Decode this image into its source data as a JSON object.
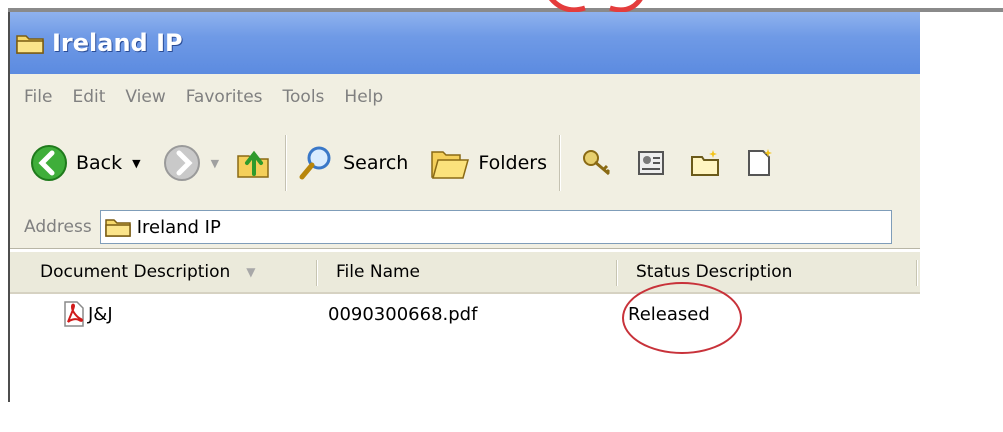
{
  "window": {
    "title": "Ireland IP"
  },
  "menu": [
    "File",
    "Edit",
    "View",
    "Favorites",
    "Tools",
    "Help"
  ],
  "toolbar": {
    "back_label": "Back",
    "search_label": "Search",
    "folders_label": "Folders"
  },
  "address": {
    "label": "Address",
    "value": "Ireland IP"
  },
  "columns": [
    "Document Description",
    "File Name",
    "Status Description"
  ],
  "rows": [
    {
      "description": "J&J",
      "file_name": "0090300668.pdf",
      "status": "Released"
    }
  ],
  "colors": {
    "titlebar": "#6f9ae6",
    "chrome": "#f1efe2",
    "annotation": "#c8323a"
  }
}
